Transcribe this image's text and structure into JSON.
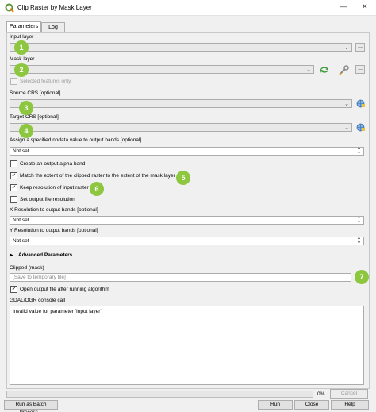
{
  "window": {
    "title": "Clip Raster by Mask Layer"
  },
  "tabs": [
    "Parameters",
    "Log"
  ],
  "params": {
    "input_layer_label": "Input layer",
    "input_layer_btn": "...",
    "mask_layer_label": "Mask layer",
    "mask_layer_btn": "...",
    "selected_only_label": "Selected features only",
    "source_crs_label": "Source CRS [optional]",
    "target_crs_label": "Target CRS [optional]",
    "nodata_label": "Assign a specified nodata value to output bands [optional]",
    "nodata_value": "Not set",
    "alpha_label": "Create an output alpha band",
    "match_extent_label": "Match the extent of the clipped raster to the extent of the mask layer",
    "keep_res_label": "Keep resolution of input raster",
    "set_res_label": "Set output file resolution",
    "x_res_label": "X Resolution to output bands [optional]",
    "x_res_value": "Not set",
    "y_res_label": "Y Resolution to output bands [optional]",
    "y_res_value": "Not set",
    "advanced_label": "Advanced Parameters",
    "clipped_label": "Clipped (mask)",
    "clipped_placeholder": "[Save to temporary file]",
    "open_output_label": "Open output file after running algorithm",
    "console_label": "GDAL/OGR console call",
    "console_text": "Invalid value for parameter 'Input layer'"
  },
  "badges": [
    "1",
    "2",
    "3",
    "4",
    "5",
    "6",
    "7"
  ],
  "bottom": {
    "progress_pct": "0%",
    "progress_value": 0,
    "cancel": "Cancel",
    "batch": "Run as Batch Process...",
    "run": "Run",
    "close": "Close",
    "help": "Help"
  },
  "colors": {
    "badge": "#8dc63f",
    "qgis_green": "#589632"
  }
}
